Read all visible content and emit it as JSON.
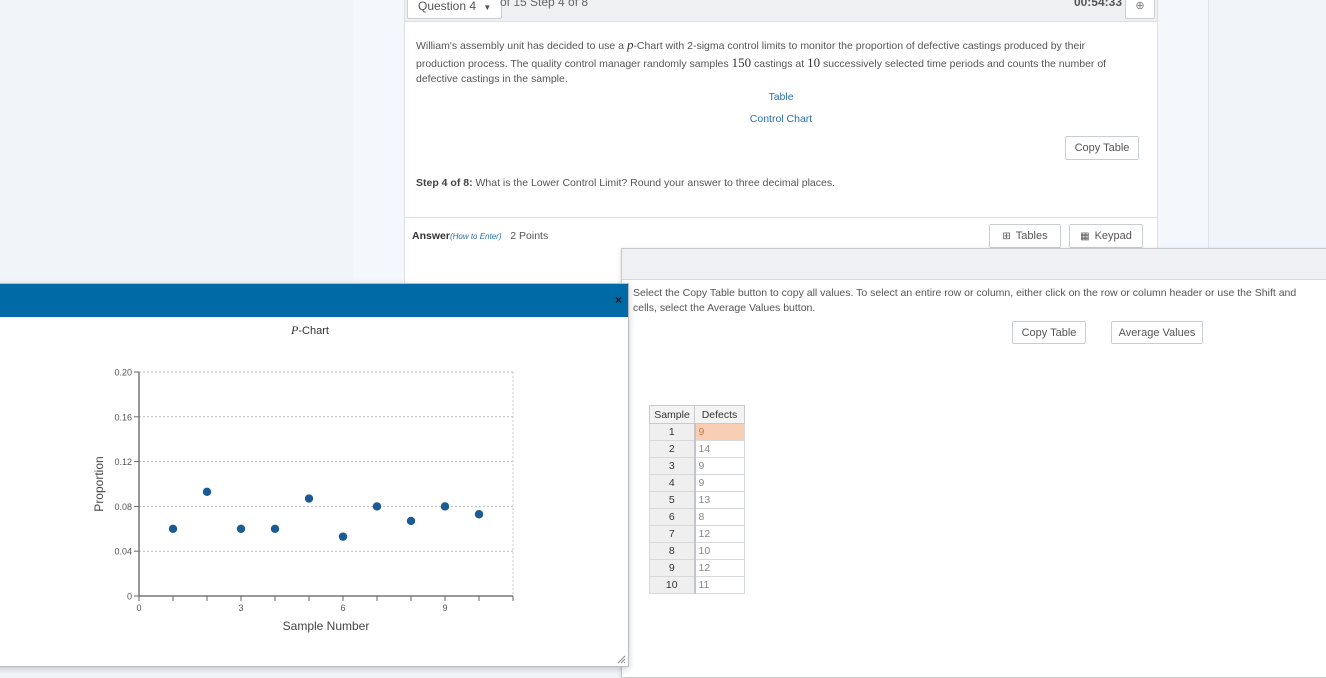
{
  "question_bar": {
    "question_dropdown": "Question 4",
    "step_info": "of 15 Step 4 of 8",
    "timer": "00:54:33",
    "flag_icon": "target-icon"
  },
  "question": {
    "text_parts": [
      "William's assembly unit has decided to use a ",
      "p",
      "-Chart with 2-sigma control limits to monitor the proportion of defective castings produced by their production process. The quality control manager randomly samples ",
      "150",
      " castings at ",
      "10",
      " successively selected time periods and counts the number of defective castings in the sample."
    ],
    "link_table": "Table",
    "link_control_chart": "Control Chart",
    "copy_table_button": "Copy Table",
    "step_label": "Step 4 of 8:",
    "step_text": " What is the Lower Control Limit? Round your answer to three decimal places.",
    "answer_label": "Answer",
    "how_to_enter": "(How to Enter)",
    "points": "2 Points",
    "tables_button": "Tables",
    "keypad_button": "Keypad"
  },
  "table_dialog": {
    "instructions_line1": "Select the Copy Table button to copy all values. To select an entire row or column, either click on the row or column header or use the Shift and",
    "instructions_line2": "cells, select the Average Values button.",
    "copy_table_button": "Copy Table",
    "average_values_button": "Average Values",
    "columns": [
      "Sample",
      "Defects"
    ],
    "rows": [
      {
        "sample": "1",
        "defects": "9"
      },
      {
        "sample": "2",
        "defects": "14"
      },
      {
        "sample": "3",
        "defects": "9"
      },
      {
        "sample": "4",
        "defects": "9"
      },
      {
        "sample": "5",
        "defects": "13"
      },
      {
        "sample": "6",
        "defects": "8"
      },
      {
        "sample": "7",
        "defects": "12"
      },
      {
        "sample": "8",
        "defects": "10"
      },
      {
        "sample": "9",
        "defects": "12"
      },
      {
        "sample": "10",
        "defects": "11"
      }
    ],
    "selected_cell": "row 1, Defects"
  },
  "chart_dialog": {
    "close_label": "×"
  },
  "chart_data": {
    "type": "scatter",
    "title_italic": "P",
    "title_rest": "-Chart",
    "xlabel": "Sample Number",
    "ylabel": "Proportion",
    "xlim": [
      0,
      11
    ],
    "ylim": [
      0,
      0.2
    ],
    "xticks": [
      0,
      1,
      2,
      3,
      4,
      5,
      6,
      7,
      8,
      9,
      10,
      11
    ],
    "xtick_labels": {
      "0": "0",
      "3": "3",
      "6": "6",
      "9": "9"
    },
    "yticks": [
      0,
      0.04,
      0.08,
      0.12,
      0.16,
      0.2
    ],
    "ytick_labels": [
      "0",
      "0.04",
      "0.08",
      "0.12",
      "0.16",
      "0.20"
    ],
    "grid": true,
    "point_color": "#1a5a96",
    "x": [
      1,
      2,
      3,
      4,
      5,
      6,
      7,
      8,
      9,
      10
    ],
    "y": [
      0.06,
      0.093,
      0.06,
      0.06,
      0.087,
      0.053,
      0.08,
      0.067,
      0.08,
      0.073
    ]
  }
}
